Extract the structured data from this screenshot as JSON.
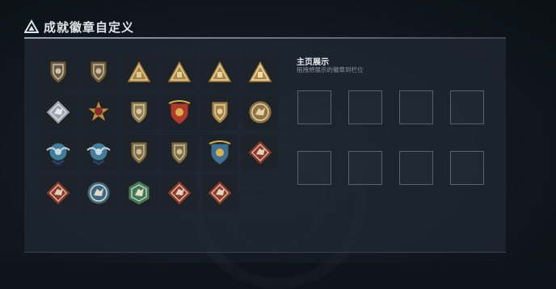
{
  "header": {
    "title": "成就徽章自定义",
    "icon": "warning-triangle-icon"
  },
  "showcase": {
    "title": "主页展示",
    "hint": "拖拽想展示的徽章到栏位",
    "slot_count": 8
  },
  "badges": [
    {
      "name": "triangle-dark-badge-icon",
      "shape": "shield",
      "fill": "#6b5a3e",
      "accent": "#c9c2b2"
    },
    {
      "name": "helicopter-badge-icon",
      "shape": "shield",
      "fill": "#6f5c3d",
      "accent": "#c8bba0"
    },
    {
      "name": "triangle-gold-badge-1-icon",
      "shape": "triangle",
      "fill": "#a4834a",
      "accent": "#e2c98a"
    },
    {
      "name": "triangle-gold-badge-2-icon",
      "shape": "triangle",
      "fill": "#a7854b",
      "accent": "#e6cf93"
    },
    {
      "name": "triangle-gold-badge-3-icon",
      "shape": "triangle",
      "fill": "#a9884d",
      "accent": "#ead59b"
    },
    {
      "name": "triangle-gold-badge-4-icon",
      "shape": "triangle",
      "fill": "#ab8a4f",
      "accent": "#efdca3"
    },
    {
      "name": "diamond-silver-badge-icon",
      "shape": "diamond",
      "fill": "#9aa3ac",
      "accent": "#e3e8ec"
    },
    {
      "name": "star-medal-badge-icon",
      "shape": "star",
      "fill": "#b69142",
      "accent": "#8a2a2a"
    },
    {
      "name": "shield-chevron-badge-icon",
      "shape": "shield",
      "fill": "#8c7a52",
      "accent": "#d6c79b"
    },
    {
      "name": "crest-red-badge-icon",
      "shape": "crest",
      "fill": "#b23a2d",
      "accent": "#d9b04c"
    },
    {
      "name": "shield-lion-badge-icon",
      "shape": "shield",
      "fill": "#a0824a",
      "accent": "#e3cf97"
    },
    {
      "name": "round-medal-badge-icon",
      "shape": "circle",
      "fill": "#8e7548",
      "accent": "#e4d2a2"
    },
    {
      "name": "wing-blue-badge-1-icon",
      "shape": "wing",
      "fill": "#3f7f9a",
      "accent": "#c9d7df"
    },
    {
      "name": "wing-blue-badge-2-icon",
      "shape": "wing",
      "fill": "#417f9d",
      "accent": "#cbd9e2"
    },
    {
      "name": "shield-wing-badge-1-icon",
      "shape": "shield",
      "fill": "#7b6a47",
      "accent": "#cdbd92"
    },
    {
      "name": "shield-wing-badge-2-icon",
      "shape": "shield",
      "fill": "#7c6b48",
      "accent": "#cfbf94"
    },
    {
      "name": "crest-gold-blue-badge-icon",
      "shape": "crest",
      "fill": "#3b6f93",
      "accent": "#d9b04c"
    },
    {
      "name": "wolf-red-badge-1-icon",
      "shape": "diamond",
      "fill": "#8d3a2e",
      "accent": "#e3d2b8"
    },
    {
      "name": "wolf-red-badge-2-icon",
      "shape": "diamond",
      "fill": "#8b3a2f",
      "accent": "#e0cfb5"
    },
    {
      "name": "wolf-round-badge-icon",
      "shape": "circle",
      "fill": "#3d6a82",
      "accent": "#e0d9c8"
    },
    {
      "name": "wolf-hex-badge-icon",
      "shape": "hex",
      "fill": "#3f7a5c",
      "accent": "#e5dcc4"
    },
    {
      "name": "wolf-red-badge-3-icon",
      "shape": "diamond",
      "fill": "#8e3b2f",
      "accent": "#e3d2b8"
    },
    {
      "name": "wolf-red-badge-4-icon",
      "shape": "diamond",
      "fill": "#8f3c30",
      "accent": "#e5d4ba"
    }
  ]
}
